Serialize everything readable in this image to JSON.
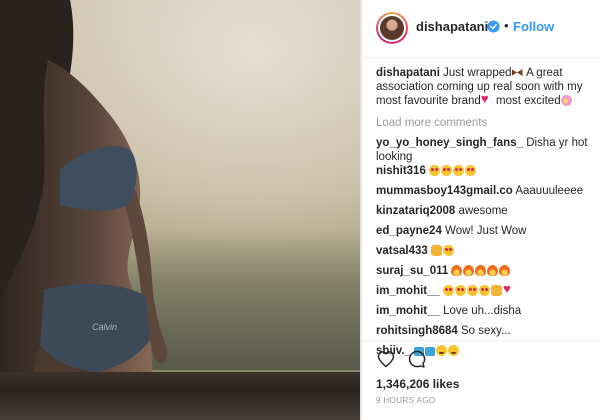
{
  "header": {
    "username": "dishapatani",
    "separator": "•",
    "follow_label": "Follow",
    "verified_icon": "verified-badge-icon",
    "accent_color": "#3897f0"
  },
  "caption": {
    "username": "dishapatani",
    "text_1": "Just wrapped",
    "text_2": " A great association coming up real soon with my most favourite brand",
    "text_3": "  most excited"
  },
  "load_more_label": "Load more comments",
  "comments": [
    {
      "username": "yo_yo_honey_singh_fans_",
      "text": " Disha yr hot looking"
    },
    {
      "username": "nishit316",
      "text": ""
    },
    {
      "username": "mummasboy143gmail.co",
      "text": " Aaauuuleeee"
    },
    {
      "username": "kinzatariq2008",
      "text": " awesome"
    },
    {
      "username": "ed_payne24",
      "text": " Wow! Just Wow"
    },
    {
      "username": "vatsal433",
      "text": ""
    },
    {
      "username": "suraj_su_011",
      "text": ""
    },
    {
      "username": "im_mohit__",
      "text": ""
    },
    {
      "username": "im_mohit__",
      "text": " Love uh...disha"
    },
    {
      "username": "rohitsingh8684",
      "text": " So sexy..."
    },
    {
      "username": "shiiv._",
      "text": ""
    }
  ],
  "actions": {
    "like_icon": "heart-outline-icon",
    "comment_icon": "comment-bubble-icon"
  },
  "likes_text": "1,346,206 likes",
  "time_text": "9 HOURS AGO"
}
